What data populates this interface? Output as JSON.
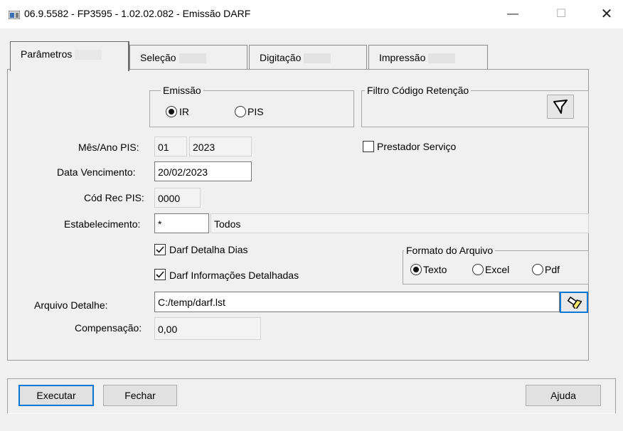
{
  "window": {
    "title": "06.9.5582 - FP3595 - 1.02.02.082 - Emissão DARF",
    "minimize": "—",
    "maximize": "☐",
    "close": "✕"
  },
  "tabs": [
    {
      "label": "Parâmetros",
      "active": true
    },
    {
      "label": "Seleção",
      "active": false
    },
    {
      "label": "Digitação",
      "active": false
    },
    {
      "label": "Impressão",
      "active": false
    }
  ],
  "emissao": {
    "legend": "Emissão",
    "options": [
      {
        "label": "IR",
        "selected": true
      },
      {
        "label": "PIS",
        "selected": false
      }
    ]
  },
  "filtro": {
    "legend": "Filtro Código Retenção"
  },
  "mes_ano_pis": {
    "label": "Mês/Ano PIS:",
    "month": "01",
    "year": "2023"
  },
  "data_vencimento": {
    "label": "Data Vencimento:",
    "value": "20/02/2023"
  },
  "cod_rec_pis": {
    "label": "Cód Rec PIS:",
    "value": "0000"
  },
  "estabelecimento": {
    "label": "Estabelecimento:",
    "value": "*",
    "description": "Todos"
  },
  "prestador_servico": {
    "label": "Prestador Serviço",
    "checked": false
  },
  "darf_detalha_dias": {
    "label": "Darf Detalha Dias",
    "checked": true
  },
  "darf_info_detalhadas": {
    "label": "Darf Informações Detalhadas",
    "checked": true
  },
  "formato": {
    "legend": "Formato do Arquivo",
    "options": [
      {
        "label": "Texto",
        "selected": true
      },
      {
        "label": "Excel",
        "selected": false
      },
      {
        "label": "Pdf",
        "selected": false
      }
    ]
  },
  "arquivo_detalhe": {
    "label": "Arquivo Detalhe:",
    "value": "C:/temp/darf.lst"
  },
  "compensacao": {
    "label": "Compensação:",
    "value": "0,00"
  },
  "buttons": {
    "executar": "Executar",
    "fechar": "Fechar",
    "ajuda": "Ajuda"
  },
  "icons": {
    "filter": "filter-funnel-icon",
    "file_search": "flashlight-icon"
  },
  "colors": {
    "accent": "#0078d7"
  }
}
